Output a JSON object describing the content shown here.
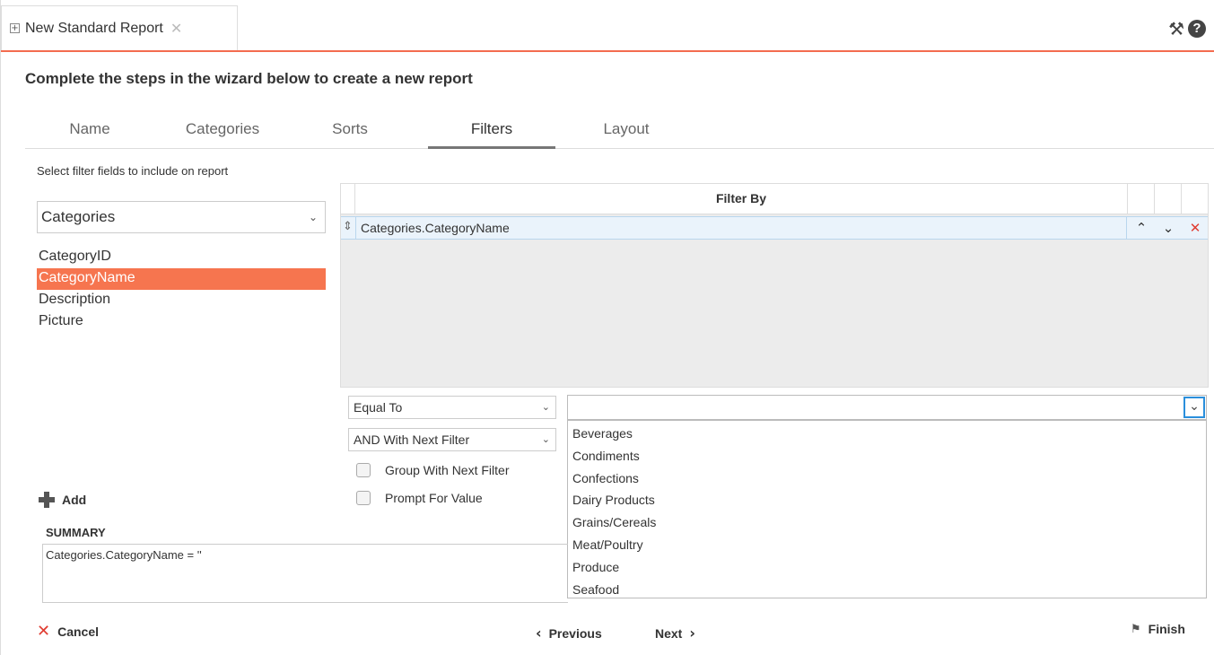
{
  "doc_tab": {
    "title": "New Standard Report"
  },
  "heading": "Complete the steps in the wizard below to create a new report",
  "wizard_tabs": [
    "Name",
    "Categories",
    "Sorts",
    "Filters",
    "Layout"
  ],
  "active_tab": "Filters",
  "instruction": "Select filter fields to include on report",
  "table_select": {
    "value": "Categories"
  },
  "fields": [
    "CategoryID",
    "CategoryName",
    "Description",
    "Picture"
  ],
  "selected_field": "CategoryName",
  "grid": {
    "header": "Filter By",
    "rows": [
      {
        "field": "Categories.CategoryName"
      }
    ]
  },
  "operator_select": {
    "value": "Equal To"
  },
  "conjunction_select": {
    "value": "AND With Next Filter"
  },
  "checkboxes": {
    "group": "Group With Next Filter",
    "prompt": "Prompt For Value"
  },
  "value_input": {
    "value": ""
  },
  "value_options": [
    "Beverages",
    "Condiments",
    "Confections",
    "Dairy Products",
    "Grains/Cereals",
    "Meat/Poultry",
    "Produce",
    "Seafood"
  ],
  "add_label": "Add",
  "summary": {
    "label": "SUMMARY",
    "text": "Categories.CategoryName = ''"
  },
  "footer": {
    "cancel": "Cancel",
    "previous": "Previous",
    "next": "Next",
    "finish": "Finish"
  },
  "colors": {
    "accent": "#f36c4f",
    "selected": "#f6754f",
    "focus": "#2a8fdc",
    "delete": "#e03c31"
  },
  "icons": [
    "expand-icon",
    "close-icon",
    "tools-icon",
    "help-icon",
    "sort-handle-icon",
    "move-up-icon",
    "move-down-icon",
    "delete-icon",
    "chevron-down-icon",
    "plus-icon",
    "x-icon",
    "chevron-left-icon",
    "chevron-right-icon",
    "finish-flag-icon"
  ]
}
